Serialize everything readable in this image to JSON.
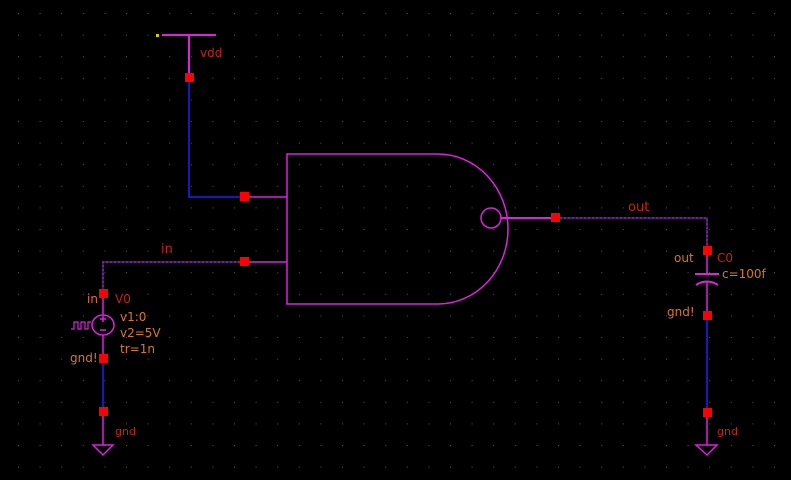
{
  "colors": {
    "wire": "#2020ff",
    "symbol": "#e020e0",
    "pin": "#ff0000",
    "net_label": "#c8201c",
    "param": "#d9791a",
    "background": "#000000"
  },
  "labels": {
    "vdd": "vdd",
    "net_in": "in",
    "net_out": "out"
  },
  "source": {
    "instance": "V0",
    "pin_pos": "in",
    "pin_neg": "gnd!",
    "params": [
      "v1:0",
      "v2=5V",
      "tr=1n"
    ],
    "icon": "pulse-icon",
    "ground_label": "gnd"
  },
  "capacitor": {
    "instance": "C0",
    "pin_pos": "out",
    "pin_neg": "gnd!",
    "param": "c=100f",
    "ground_label": "gnd"
  }
}
